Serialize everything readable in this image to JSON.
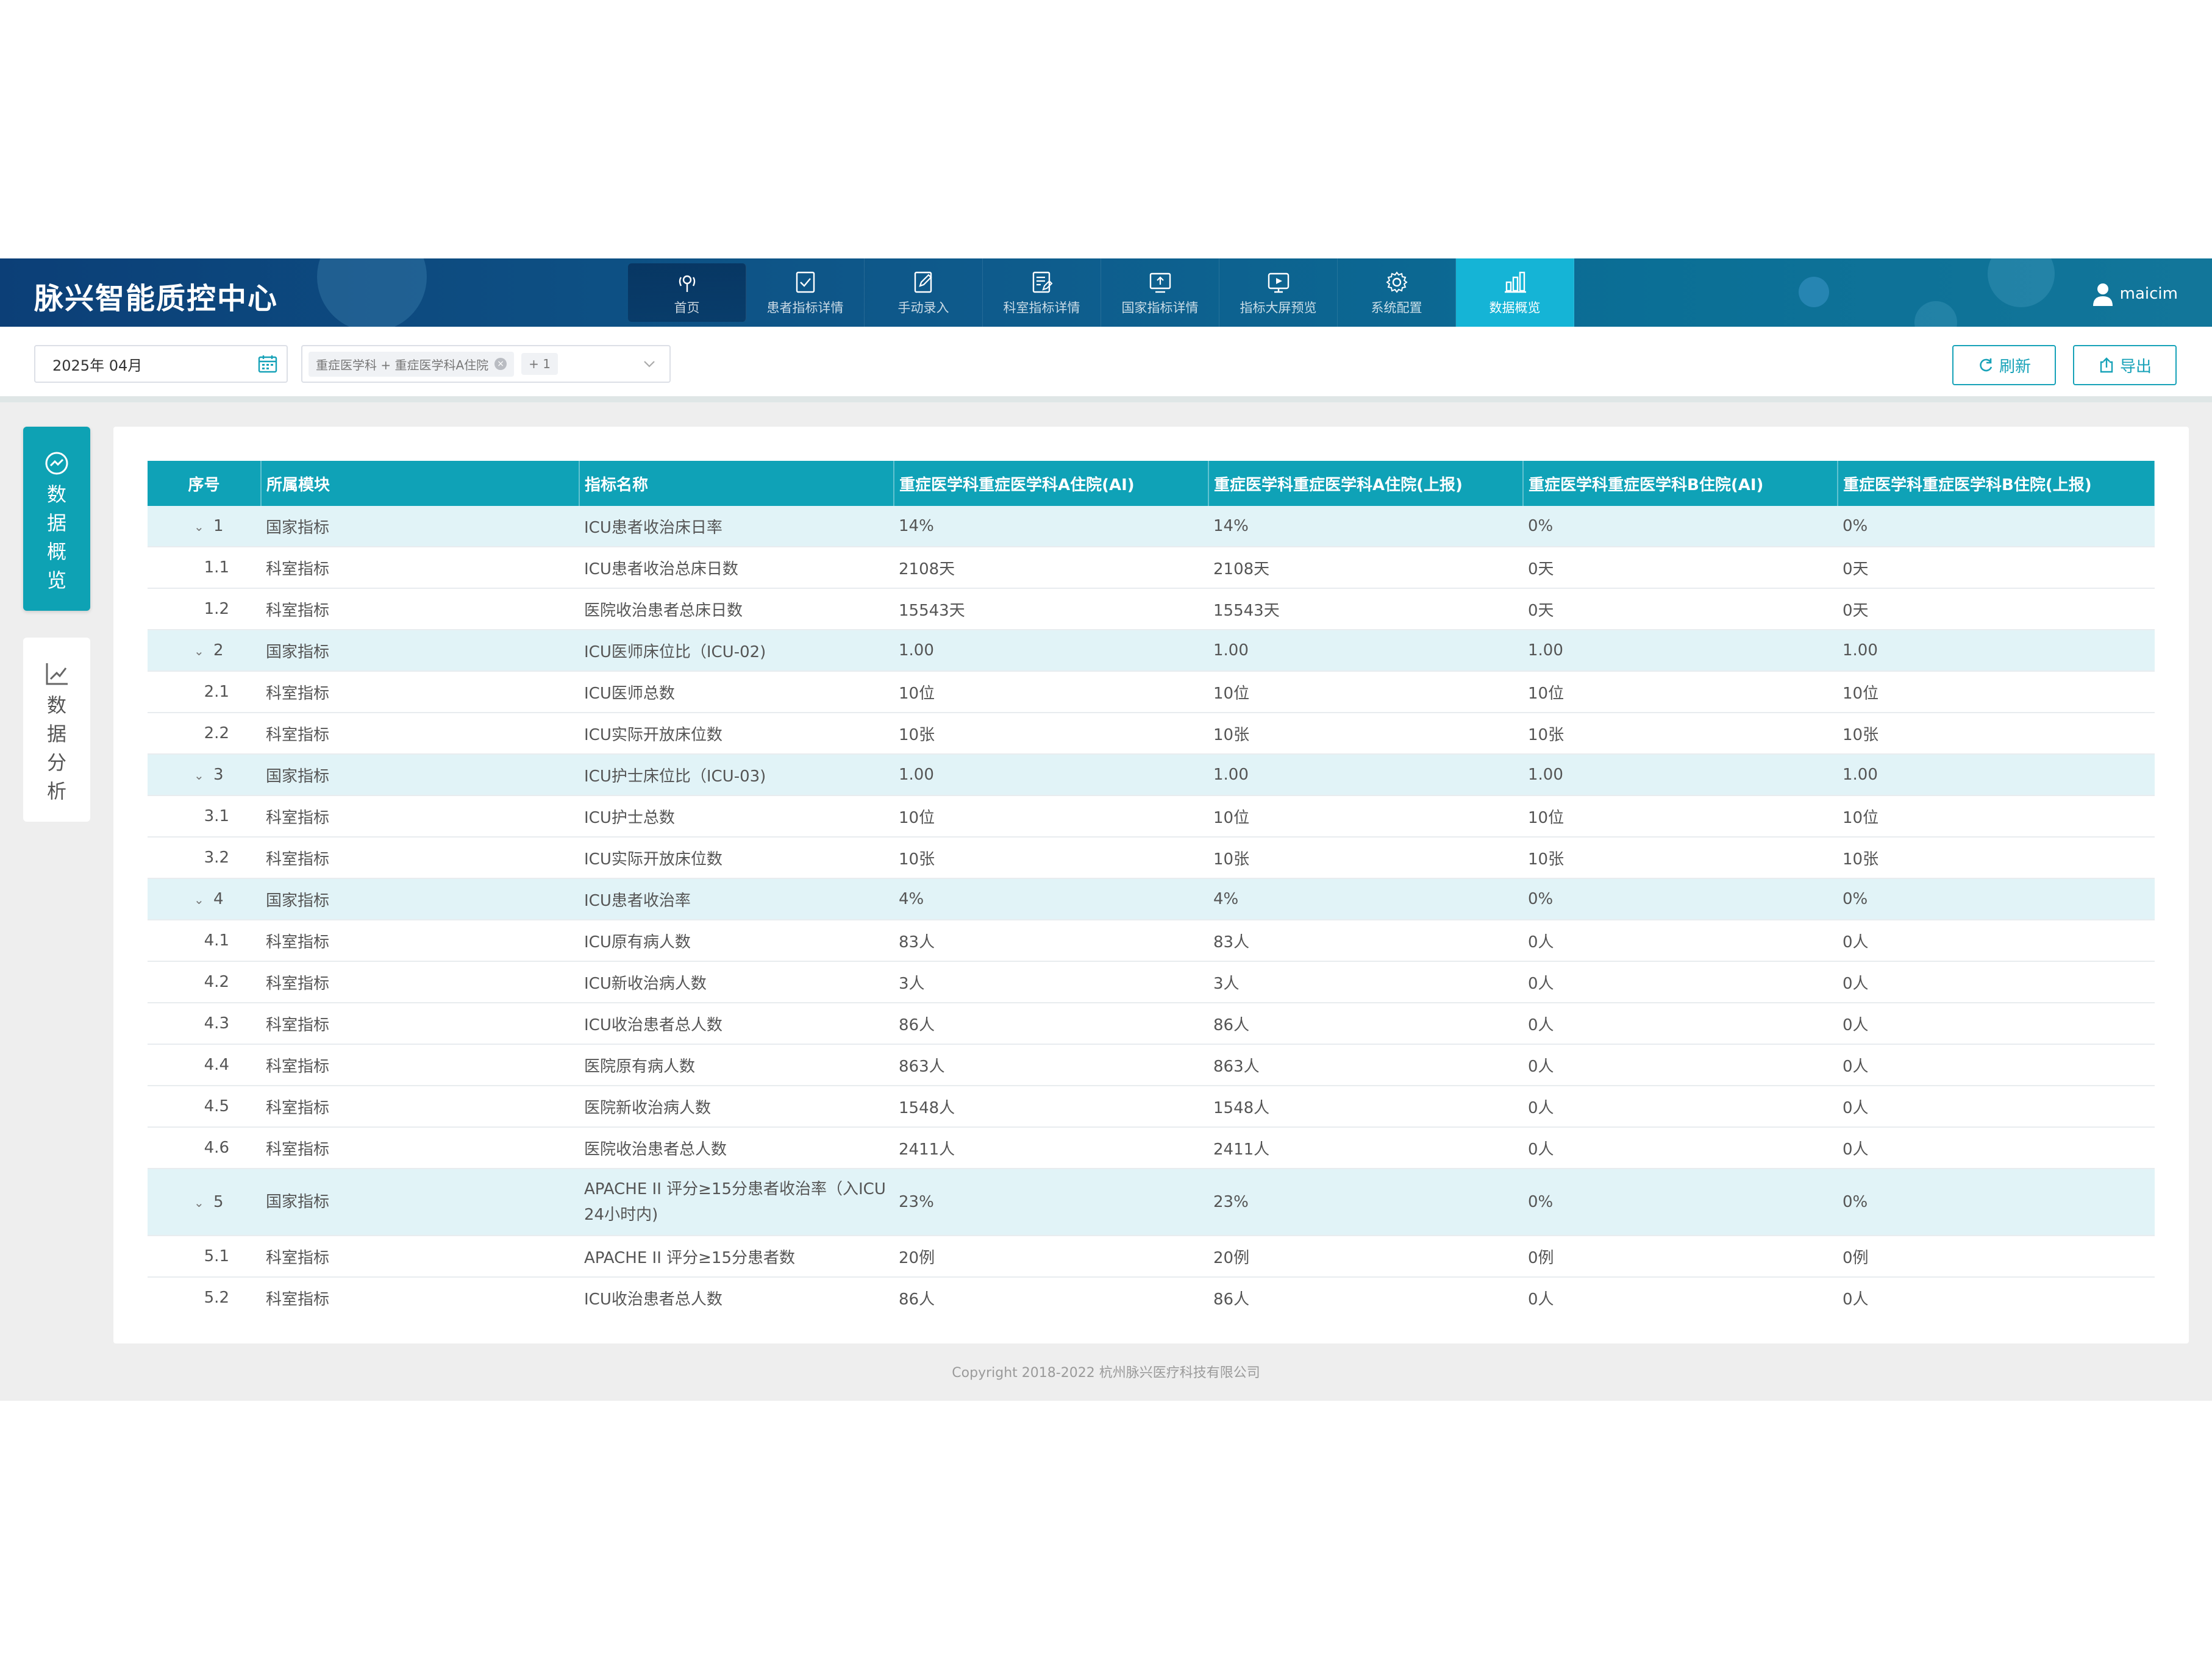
{
  "header": {
    "title": "脉兴智能质控中心",
    "nav": [
      {
        "label": "首页",
        "icon": "home-icon"
      },
      {
        "label": "患者指标详情",
        "icon": "checklist-icon"
      },
      {
        "label": "手动录入",
        "icon": "edit-icon"
      },
      {
        "label": "科室指标详情",
        "icon": "document-edit-icon"
      },
      {
        "label": "国家指标详情",
        "icon": "upload-monitor-icon"
      },
      {
        "label": "指标大屏预览",
        "icon": "screen-icon"
      },
      {
        "label": "系统配置",
        "icon": "gear-icon"
      },
      {
        "label": "数据概览",
        "icon": "bar-chart-icon",
        "active": true
      }
    ],
    "user": "maicim"
  },
  "toolbar": {
    "date_value": "2025年 04月",
    "dept_tag": "重症医学科 + 重症医学科A住院",
    "dept_more": "+ 1",
    "refresh_label": "刷新",
    "export_label": "导出"
  },
  "side": {
    "tab1": "数据概览",
    "tab2": "数据分析"
  },
  "table": {
    "headers": [
      "序号",
      "所属模块",
      "指标名称",
      "重症医学科重症医学科A住院(AI)",
      "重症医学科重症医学科A住院(上报)",
      "重症医学科重症医学科B住院(AI)",
      "重症医学科重症医学科B住院(上报)"
    ],
    "rows": [
      {
        "seq": "1",
        "parent": true,
        "module": "国家指标",
        "name": "ICU患者收治床日率",
        "a_ai": "14%",
        "a_rep": "14%",
        "b_ai": "0%",
        "b_rep": "0%"
      },
      {
        "seq": "1.1",
        "module": "科室指标",
        "name": "ICU患者收治总床日数",
        "a_ai": "2108天",
        "a_rep": "2108天",
        "b_ai": "0天",
        "b_rep": "0天"
      },
      {
        "seq": "1.2",
        "module": "科室指标",
        "name": "医院收治患者总床日数",
        "a_ai": "15543天",
        "a_rep": "15543天",
        "b_ai": "0天",
        "b_rep": "0天"
      },
      {
        "seq": "2",
        "parent": true,
        "module": "国家指标",
        "name": "ICU医师床位比（ICU-02)",
        "a_ai": "1.00",
        "a_rep": "1.00",
        "b_ai": "1.00",
        "b_rep": "1.00"
      },
      {
        "seq": "2.1",
        "module": "科室指标",
        "name": "ICU医师总数",
        "a_ai": "10位",
        "a_rep": "10位",
        "b_ai": "10位",
        "b_rep": "10位"
      },
      {
        "seq": "2.2",
        "module": "科室指标",
        "name": "ICU实际开放床位数",
        "a_ai": "10张",
        "a_rep": "10张",
        "b_ai": "10张",
        "b_rep": "10张"
      },
      {
        "seq": "3",
        "parent": true,
        "module": "国家指标",
        "name": "ICU护士床位比（ICU-03)",
        "a_ai": "1.00",
        "a_rep": "1.00",
        "b_ai": "1.00",
        "b_rep": "1.00"
      },
      {
        "seq": "3.1",
        "module": "科室指标",
        "name": "ICU护士总数",
        "a_ai": "10位",
        "a_rep": "10位",
        "b_ai": "10位",
        "b_rep": "10位"
      },
      {
        "seq": "3.2",
        "module": "科室指标",
        "name": "ICU实际开放床位数",
        "a_ai": "10张",
        "a_rep": "10张",
        "b_ai": "10张",
        "b_rep": "10张"
      },
      {
        "seq": "4",
        "parent": true,
        "module": "国家指标",
        "name": "ICU患者收治率",
        "a_ai": "4%",
        "a_rep": "4%",
        "b_ai": "0%",
        "b_rep": "0%"
      },
      {
        "seq": "4.1",
        "module": "科室指标",
        "name": "ICU原有病人数",
        "a_ai": "83人",
        "a_rep": "83人",
        "b_ai": "0人",
        "b_rep": "0人"
      },
      {
        "seq": "4.2",
        "module": "科室指标",
        "name": "ICU新收治病人数",
        "a_ai": "3人",
        "a_rep": "3人",
        "b_ai": "0人",
        "b_rep": "0人"
      },
      {
        "seq": "4.3",
        "module": "科室指标",
        "name": "ICU收治患者总人数",
        "a_ai": "86人",
        "a_rep": "86人",
        "b_ai": "0人",
        "b_rep": "0人"
      },
      {
        "seq": "4.4",
        "module": "科室指标",
        "name": "医院原有病人数",
        "a_ai": "863人",
        "a_rep": "863人",
        "b_ai": "0人",
        "b_rep": "0人"
      },
      {
        "seq": "4.5",
        "module": "科室指标",
        "name": "医院新收治病人数",
        "a_ai": "1548人",
        "a_rep": "1548人",
        "b_ai": "0人",
        "b_rep": "0人"
      },
      {
        "seq": "4.6",
        "module": "科室指标",
        "name": "医院收治患者总人数",
        "a_ai": "2411人",
        "a_rep": "2411人",
        "b_ai": "0人",
        "b_rep": "0人"
      },
      {
        "seq": "5",
        "parent": true,
        "tall": true,
        "module": "国家指标",
        "name": "APACHE II 评分≥15分患者收治率（入ICU 24小时内)",
        "a_ai": "23%",
        "a_rep": "23%",
        "b_ai": "0%",
        "b_rep": "0%"
      },
      {
        "seq": "5.1",
        "module": "科室指标",
        "name": "APACHE II 评分≥15分患者数",
        "a_ai": "20例",
        "a_rep": "20例",
        "b_ai": "0例",
        "b_rep": "0例"
      },
      {
        "seq": "5.2",
        "module": "科室指标",
        "name": "ICU收治患者总人数",
        "a_ai": "86人",
        "a_rep": "86人",
        "b_ai": "0人",
        "b_rep": "0人"
      }
    ]
  },
  "footer": "Copyright 2018-2022 杭州脉兴医疗科技有限公司",
  "colors": {
    "header": "#0c3f77",
    "accent": "#15b4d6",
    "table_header": "#0fa2b7",
    "parent_row": "#e1f3f7"
  }
}
